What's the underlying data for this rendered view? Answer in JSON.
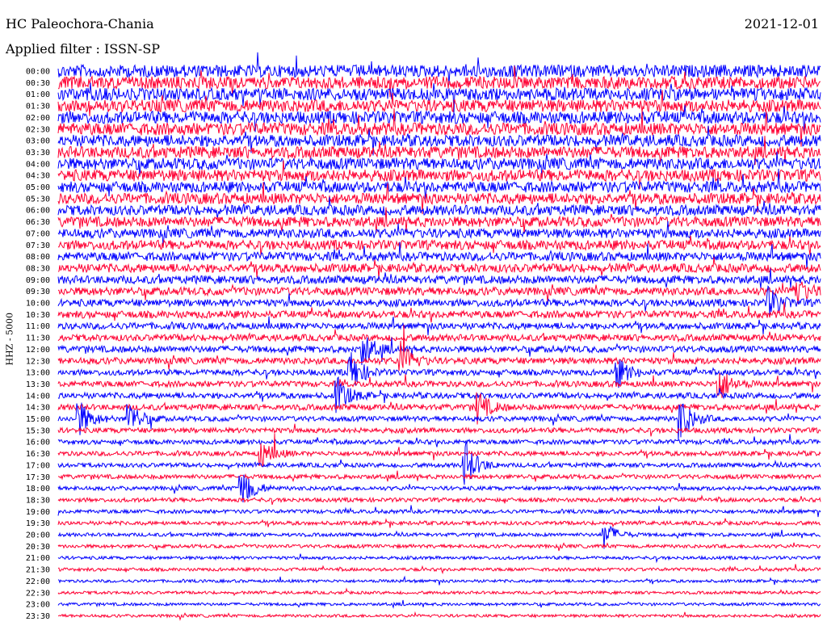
{
  "header": {
    "station": "HC Paleochora-Chania",
    "filter": "Applied filter : ISSN-SP",
    "date": "2021-12-01",
    "channel": "HHZ - 5000"
  },
  "colors": {
    "trace_a": "#0000ff",
    "trace_b": "#ff0033",
    "background": "#ffffff"
  },
  "chart_data": {
    "type": "line",
    "title": "HC Paleochora-Chania",
    "subtitle": "Applied filter : ISSN-SP",
    "date": "2021-12-01",
    "ylabel": "HHZ - 5000",
    "xlabel": "",
    "grid": false,
    "x_range_minutes": [
      0,
      30
    ],
    "row_labels": [
      "00:00",
      "00:30",
      "01:00",
      "01:30",
      "02:00",
      "02:30",
      "03:00",
      "03:30",
      "04:00",
      "04:30",
      "05:00",
      "05:30",
      "06:00",
      "06:30",
      "07:00",
      "07:30",
      "08:00",
      "08:30",
      "09:00",
      "09:30",
      "10:00",
      "10:30",
      "11:00",
      "11:30",
      "12:00",
      "12:30",
      "13:00",
      "13:30",
      "14:00",
      "14:30",
      "15:00",
      "15:30",
      "16:00",
      "16:30",
      "17:00",
      "17:30",
      "18:00",
      "18:30",
      "19:00",
      "19:30",
      "20:00",
      "20:30",
      "21:00",
      "21:30",
      "22:00",
      "22:30",
      "23:00",
      "23:30"
    ],
    "row_colors": [
      "trace_a",
      "trace_b"
    ],
    "noise_level": [
      0.85,
      0.85,
      0.85,
      0.85,
      0.85,
      0.85,
      0.8,
      0.8,
      0.8,
      0.8,
      0.75,
      0.75,
      0.7,
      0.7,
      0.65,
      0.65,
      0.6,
      0.6,
      0.55,
      0.55,
      0.5,
      0.5,
      0.45,
      0.45,
      0.45,
      0.45,
      0.4,
      0.4,
      0.4,
      0.4,
      0.35,
      0.35,
      0.32,
      0.32,
      0.3,
      0.3,
      0.28,
      0.28,
      0.26,
      0.26,
      0.24,
      0.24,
      0.22,
      0.22,
      0.2,
      0.2,
      0.2,
      0.2
    ],
    "events": [
      {
        "row": 24,
        "minute": 12.0,
        "amp": 1.4
      },
      {
        "row": 25,
        "minute": 13.5,
        "amp": 1.6
      },
      {
        "row": 26,
        "minute": 11.5,
        "amp": 1.8
      },
      {
        "row": 26,
        "minute": 22.0,
        "amp": 1.3
      },
      {
        "row": 27,
        "minute": 26.0,
        "amp": 1.6
      },
      {
        "row": 28,
        "minute": 11.0,
        "amp": 1.5
      },
      {
        "row": 29,
        "minute": 16.5,
        "amp": 1.4
      },
      {
        "row": 30,
        "minute": 0.8,
        "amp": 1.7
      },
      {
        "row": 30,
        "minute": 2.8,
        "amp": 1.5
      },
      {
        "row": 30,
        "minute": 24.5,
        "amp": 1.9
      },
      {
        "row": 33,
        "minute": 8.0,
        "amp": 1.4
      },
      {
        "row": 34,
        "minute": 16.0,
        "amp": 2.2
      },
      {
        "row": 36,
        "minute": 7.2,
        "amp": 2.0
      },
      {
        "row": 40,
        "minute": 21.5,
        "amp": 1.2
      },
      {
        "row": 19,
        "minute": 29.0,
        "amp": 1.3
      },
      {
        "row": 20,
        "minute": 28.0,
        "amp": 1.2
      }
    ]
  }
}
